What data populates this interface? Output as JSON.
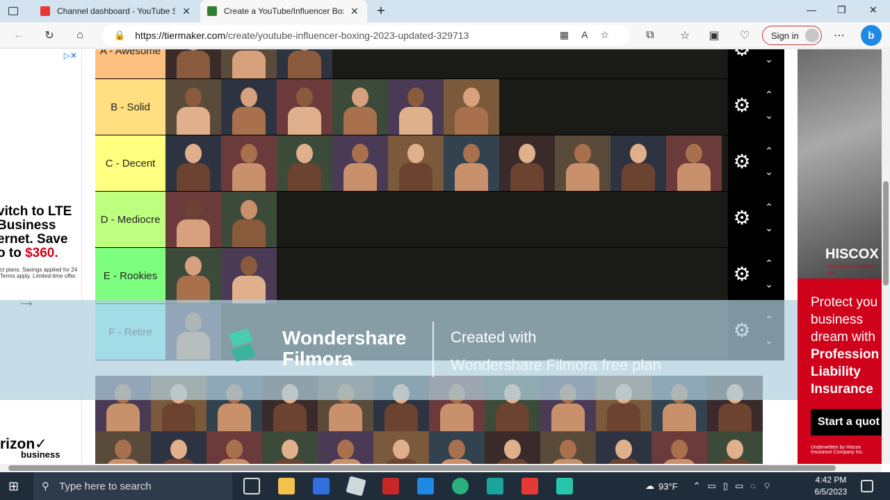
{
  "browser": {
    "tabs": [
      {
        "title": "Channel dashboard - YouTube St",
        "favicon_color": "#e53935",
        "active": false
      },
      {
        "title": "Create a YouTube/Influencer Box",
        "favicon_color": "#2e7d32",
        "active": true
      }
    ],
    "new_tab": "+",
    "url_host": "https://tiermaker.com",
    "url_path": "/create/youtube-influencer-boxing-2023-updated-329713",
    "sign_in": "Sign in",
    "bing": "b"
  },
  "left_ad": {
    "headline_1": "vitch to LTE",
    "headline_2": "Business",
    "headline_3": "ernet. Save",
    "headline_4": "o to ",
    "price": "$360.",
    "fine_print": "ct plans. Savings applied for 24 Terms apply. Limited-time offer.",
    "logo": "rizon✓",
    "logo_sub": "business"
  },
  "tiers": [
    {
      "label": "A - Awesome",
      "color": "#ffbf7f",
      "count": 3
    },
    {
      "label": "B - Solid",
      "color": "#ffdf7f",
      "count": 6
    },
    {
      "label": "C - Decent",
      "color": "#ffff7f",
      "count": 10
    },
    {
      "label": "D - Mediocre",
      "color": "#bfff7f",
      "count": 2
    },
    {
      "label": "E - Rookies",
      "color": "#7fff7f",
      "count": 2
    },
    {
      "label": "F - Retire",
      "color": "#7fffff",
      "count": 1
    }
  ],
  "pool_count": 24,
  "watermark": {
    "brand_line1": "Wondershare",
    "brand_line2": "Filmora",
    "created": "Created with",
    "plan": "Wondershare Filmora free plan"
  },
  "right_ad": {
    "brand": "HISCOX",
    "tagline": "business insurance ex",
    "copy_1": "Protect you business dream with",
    "copy_2": "Profession Liability Insurance",
    "cta": "Start a quot",
    "underwritten": "Underwritten by Hiscox Insurance Company Inc."
  },
  "taskbar": {
    "search_placeholder": "Type here to search",
    "temperature": "93°F",
    "time": "4:42 PM",
    "date": "6/5/2023"
  }
}
